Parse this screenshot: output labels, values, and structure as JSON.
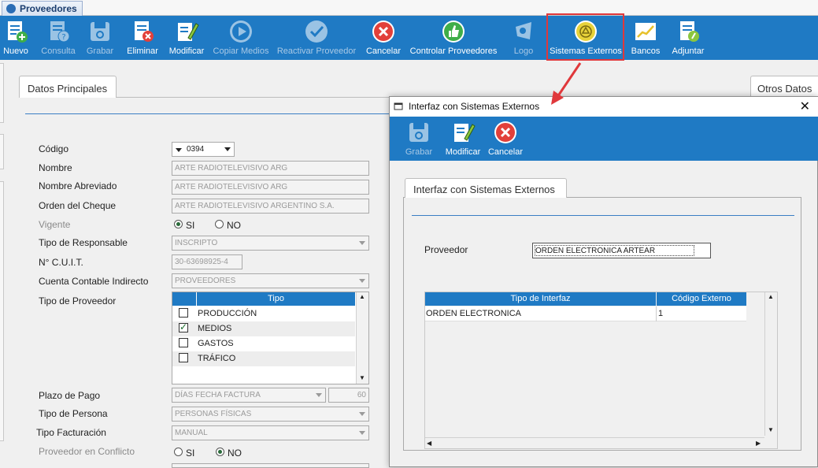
{
  "app_tab": "Proveedores",
  "toolbar": [
    {
      "label": "Nuevo",
      "icon": "new-doc-icon",
      "enabled": true
    },
    {
      "label": "Consulta",
      "icon": "query-doc-icon",
      "enabled": false
    },
    {
      "label": "Grabar",
      "icon": "save-disk-icon",
      "enabled": false
    },
    {
      "label": "Eliminar",
      "icon": "delete-doc-icon",
      "enabled": true
    },
    {
      "label": "Modificar",
      "icon": "edit-doc-icon",
      "enabled": true
    },
    {
      "label": "Copiar Medios",
      "icon": "play-icon",
      "enabled": false
    },
    {
      "label": "Reactivar Proveedor",
      "icon": "check-icon",
      "enabled": false
    },
    {
      "label": "Cancelar",
      "icon": "cancel-icon",
      "enabled": true
    },
    {
      "label": "Controlar Proveedores",
      "icon": "thumbs-up-icon",
      "enabled": true
    },
    {
      "label": "Logo",
      "icon": "logo-icon",
      "enabled": false
    },
    {
      "label": "Sistemas Externos",
      "icon": "external-systems-icon",
      "enabled": true
    },
    {
      "label": "Bancos",
      "icon": "chart-icon",
      "enabled": true
    },
    {
      "label": "Adjuntar",
      "icon": "attach-icon",
      "enabled": true
    }
  ],
  "main_tab": "Datos Principales",
  "other_tab": "Otros Datos",
  "form": {
    "codigo_label": "Código",
    "codigo_value": "0394",
    "nombre_label": "Nombre",
    "nombre_value": "ARTE RADIOTELEVISIVO ARG",
    "nombre_abrev_label": "Nombre Abreviado",
    "nombre_abrev_value": "ARTE RADIOTELEVISIVO ARG",
    "orden_cheque_label": "Orden del Cheque",
    "orden_cheque_value": "ARTE RADIOTELEVISIVO ARGENTINO S.A.",
    "vigente_label": "Vigente",
    "vigente_si": "SI",
    "vigente_no": "NO",
    "tipo_resp_label": "Tipo de Responsable",
    "tipo_resp_value": "INSCRIPTO",
    "cuit_label": "N° C.U.I.T.",
    "cuit_value": "30-63698925-4",
    "cuenta_label": "Cuenta Contable Indirecto",
    "cuenta_value": "PROVEEDORES",
    "tipo_prov_label": "Tipo de Proveedor",
    "tipo_header": "Tipo",
    "tipos": [
      {
        "name": "PRODUCCIÓN",
        "checked": false
      },
      {
        "name": "MEDIOS",
        "checked": true
      },
      {
        "name": "GASTOS",
        "checked": false
      },
      {
        "name": "TRÁFICO",
        "checked": false
      }
    ],
    "plazo_label": "Plazo de Pago",
    "plazo_value": "DÍAS FECHA FACTURA",
    "plazo_days": "60",
    "tipo_persona_label": "Tipo de Persona",
    "tipo_persona_value": "PERSONAS FÍSICAS",
    "tipo_fact_label": "Tipo Facturación",
    "tipo_fact_value": "MANUAL",
    "conflicto_label": "Proveedor en Conflicto",
    "conflicto_si": "SI",
    "conflicto_no": "NO"
  },
  "dialog": {
    "title": "Interfaz con Sistemas Externos",
    "toolbar": [
      {
        "label": "Grabar",
        "enabled": false
      },
      {
        "label": "Modificar",
        "enabled": true
      },
      {
        "label": "Cancelar",
        "enabled": true
      }
    ],
    "tab": "Interfaz con Sistemas Externos",
    "proveedor_label": "Proveedor",
    "proveedor_value": "ORDEN ELECTRONICA ARTEAR",
    "columns": [
      "Tipo de Interfaz",
      "Código Externo"
    ],
    "rows": [
      [
        "ORDEN ELECTRONICA",
        "1"
      ]
    ]
  },
  "colors": {
    "toolbar_blue": "#1f7ac4",
    "highlight_red": "#e0383b"
  }
}
